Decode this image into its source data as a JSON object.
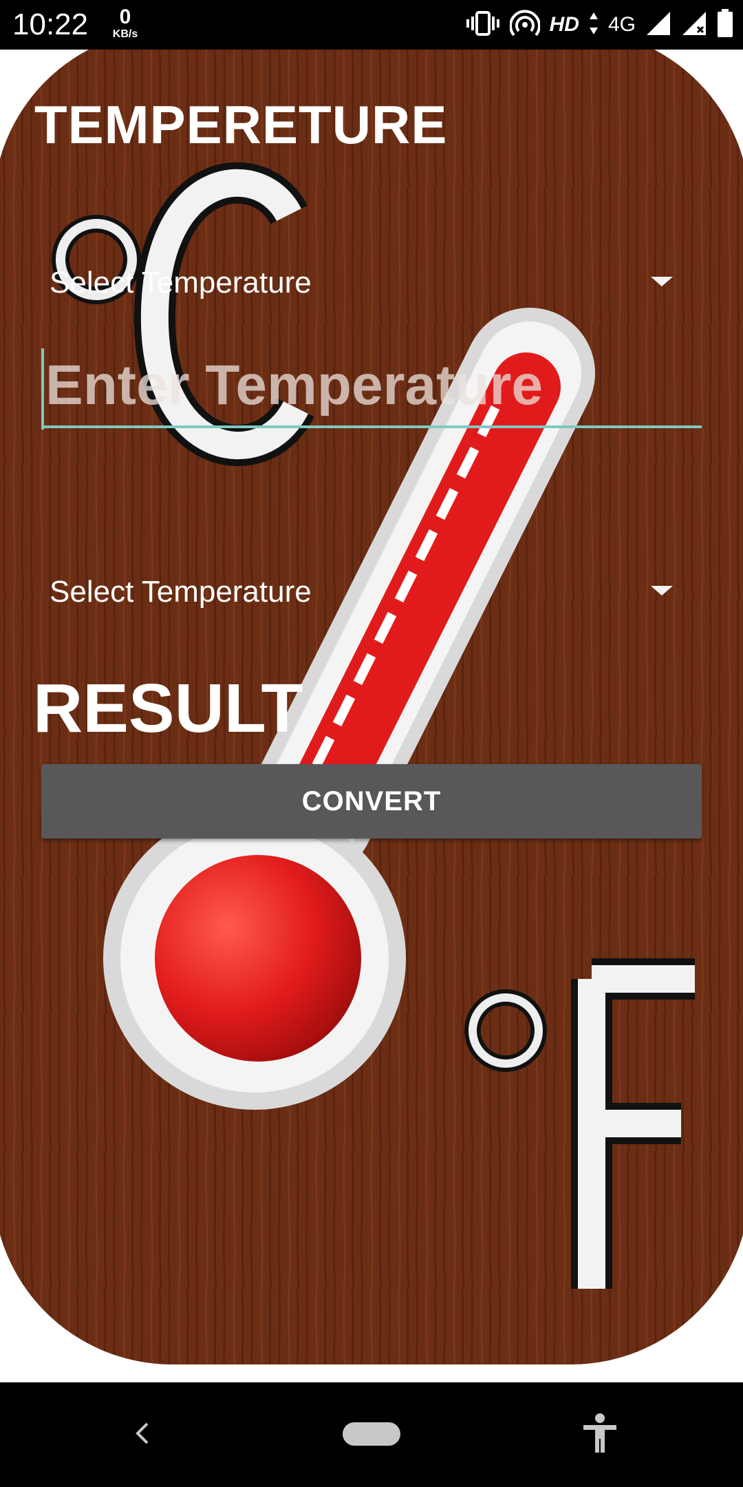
{
  "status_bar": {
    "time": "10:22",
    "net_speed_value": "0",
    "net_speed_unit": "KB/s",
    "hd_label": "HD",
    "network_label": "4G"
  },
  "app": {
    "title": "TEMPERETURE",
    "from_unit_select": {
      "selected": "Select Temperature"
    },
    "temperature_input": {
      "value": "",
      "placeholder": "Enter Temperature"
    },
    "to_unit_select": {
      "selected": "Select Temperature"
    },
    "result_label": "RESULT",
    "convert_button": "CONVERT"
  },
  "colors": {
    "wood_brown": "#6b2e14",
    "input_underline": "#7ec9c0",
    "button_gray": "#58585a",
    "thermo_red": "#e11b1b"
  }
}
